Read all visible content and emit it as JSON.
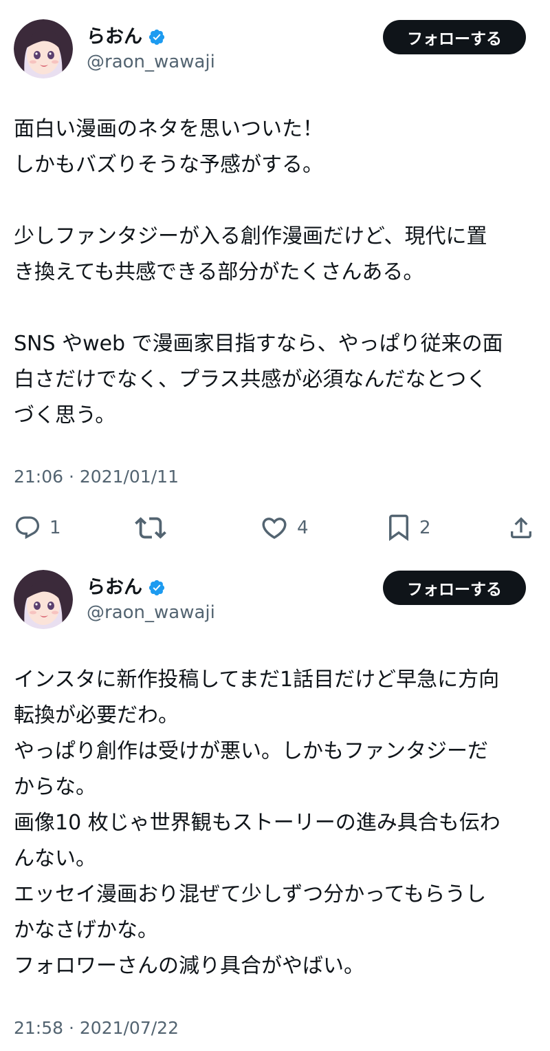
{
  "tweets": [
    {
      "author": {
        "display_name": "らおん",
        "handle": "@raon_wawaji",
        "verified": true
      },
      "follow_button_label": "フォローする",
      "text_lines": [
        "面白い漫画のネタを思いついた！",
        "しかもバズりそうな予感がする。",
        "",
        "少しファンタジーが入る創作漫画だけど、現代に置",
        "き換えても共感できる部分がたくさんある。",
        "",
        "SNS やweb で漫画家目指すなら、やっぱり従来の面",
        "白さだけでなく、プラス共感が必須なんだなとつく",
        "づく思う。"
      ],
      "timestamp": "21:06 · 2021/01/11",
      "stats": {
        "replies": "1",
        "retweets": "",
        "likes": "4",
        "bookmarks": "2"
      }
    },
    {
      "author": {
        "display_name": "らおん",
        "handle": "@raon_wawaji",
        "verified": true
      },
      "follow_button_label": "フォローする",
      "text_lines": [
        "インスタに新作投稿してまだ1話目だけど早急に方向",
        "転換が必要だわ。",
        "やっぱり創作は受けが悪い。しかもファンタジーだ",
        "からな。",
        "画像10 枚じゃ世界観もストーリーの進み具合も伝わ",
        "んない。",
        "エッセイ漫画おり混ぜて少しずつ分かってもらうし",
        "かなさげかな。",
        "フォロワーさんの減り具合がやばい。"
      ],
      "timestamp": "21:58 · 2021/07/22"
    }
  ],
  "icons": {
    "verified": "verified-badge-icon",
    "reply": "reply-icon",
    "retweet": "retweet-icon",
    "like": "heart-icon",
    "bookmark": "bookmark-icon",
    "share": "share-icon"
  },
  "colors": {
    "text_primary": "#0f1419",
    "text_secondary": "#536471",
    "verified_blue": "#1d9bf0",
    "follow_button_bg": "#0f1419",
    "follow_button_text": "#ffffff",
    "background": "#ffffff"
  }
}
